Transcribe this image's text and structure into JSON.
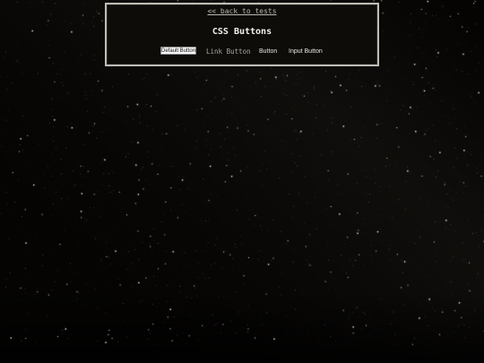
{
  "background": {
    "description_icon": "starry-night-sky",
    "base_color": "#050403",
    "star_color": "#ffffff"
  },
  "panel": {
    "back_link": "<< back to tests",
    "title": "CSS Buttons",
    "border_color": "#bdbdb6",
    "background_color": "#0d0c08"
  },
  "buttons": {
    "default_button": "Default Button",
    "link_button": "Link Button",
    "plain_button": "Button",
    "input_button": "Input Button"
  }
}
